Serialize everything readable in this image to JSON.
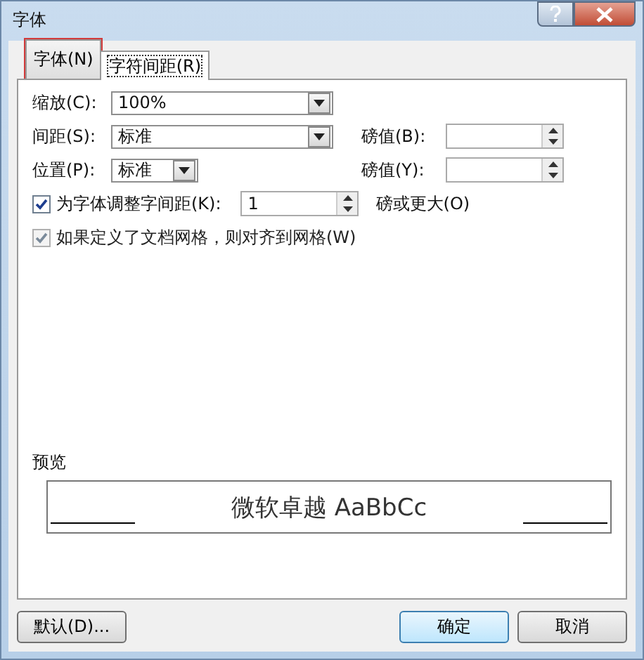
{
  "window": {
    "title": "字体"
  },
  "tabs": [
    {
      "label": "字体(N)",
      "selected": false,
      "highlighted": true
    },
    {
      "label": "字符间距(R)",
      "selected": true,
      "highlighted": false
    }
  ],
  "rows": [
    {
      "label": "缩放(C):",
      "field": {
        "kind": "combo",
        "value": "100%"
      }
    },
    {
      "label": "间距(S):",
      "field": {
        "kind": "combo",
        "value": "标准"
      },
      "side": {
        "label": "磅值(B):",
        "field": {
          "kind": "spin"
        }
      }
    },
    {
      "label": "位置(P):",
      "field": {
        "kind": "combo",
        "value": "标准"
      },
      "side": {
        "label": "磅值(Y):",
        "field": {
          "kind": "spin"
        }
      }
    }
  ],
  "checks": [
    {
      "label": "为字体调整字间距(K):",
      "checked": true,
      "disabled": false,
      "field": {
        "kind": "spin",
        "value": "1"
      },
      "suffix": "磅或更大(O)"
    },
    {
      "label": "如果定义了文档网格，则对齐到网格(W)",
      "checked": true,
      "disabled": true
    }
  ],
  "preview": {
    "label": "预览",
    "sample": "微软卓越  AaBbCc"
  },
  "buttons": [
    {
      "label": "默认(D)...",
      "kind": "left",
      "default": false
    },
    {
      "label": "确定",
      "kind": "right",
      "default": true
    },
    {
      "label": "取消",
      "kind": "right",
      "default": false
    }
  ]
}
